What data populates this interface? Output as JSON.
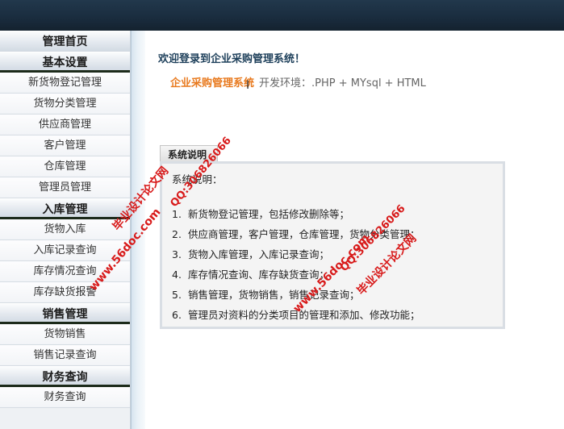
{
  "sidebar": {
    "sections": [
      {
        "header": "管理首页",
        "items": []
      },
      {
        "header": "基本设置",
        "items": [
          "新货物登记管理",
          "货物分类管理",
          "供应商管理",
          "客户管理",
          "仓库管理",
          "管理员管理"
        ]
      },
      {
        "header": "入库管理",
        "items": [
          "货物入库",
          "入库记录查询",
          "库存情况查询",
          "库存缺货报警"
        ]
      },
      {
        "header": "销售管理",
        "items": [
          "货物销售",
          "销售记录查询"
        ]
      },
      {
        "header": "财务查询",
        "items": [
          "财务查询"
        ]
      }
    ]
  },
  "main": {
    "welcome": "欢迎登录到企业采购管理系统！",
    "system_name": "企业采购管理系统",
    "env_text": "开发环境：.PHP + MYsql + HTML",
    "info_tab_label": "系统说明",
    "info_title": "系统说明：",
    "info_items": [
      {
        "num": "1.",
        "text": "新货物登记管理，包括修改删除等；"
      },
      {
        "num": "2.",
        "text": "供应商管理，客户管理，仓库管理，货物分类管理；"
      },
      {
        "num": "3.",
        "text": "货物入库管理，入库记录查询；"
      },
      {
        "num": "4.",
        "text": "库存情况查询、库存缺货查询；"
      },
      {
        "num": "5.",
        "text": "销售管理，货物销售，销售记录查询；"
      },
      {
        "num": "6.",
        "text": "管理员对资料的分类项目的管理和添加、修改功能；"
      }
    ]
  },
  "watermarks": {
    "left": {
      "site": "www.56doc.com",
      "qq": "QQ:306826066",
      "brand": "毕业设计论文网"
    },
    "right": {
      "site": "www.56doc.com",
      "qq": "QQ:306826066",
      "brand": "毕业设计论文网"
    }
  },
  "colors": {
    "topbar": "#1a2d3f",
    "accent_orange": "#e8791d",
    "welcome_text": "#1d3f5a",
    "watermark_red": "#d81a1a"
  }
}
